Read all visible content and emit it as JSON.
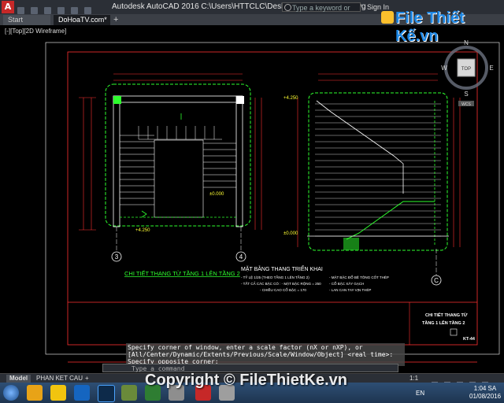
{
  "titlebar": {
    "app_logo": "A",
    "title": "Autodesk AutoCAD 2016    C:\\Users\\HTTCLC\\Desktop\\DoHoaTV.com.dwg",
    "search_placeholder": "Type a keyword or phrase",
    "sign_in": "Sign In"
  },
  "tabs": [
    {
      "label": "Start"
    },
    {
      "label": "DoHoaTV.com*"
    }
  ],
  "tab_plus": "+",
  "viewport": {
    "label": "[-][Top][2D Wireframe]"
  },
  "viewcube": {
    "top_label": "TOP",
    "north": "N",
    "south": "S",
    "east": "E",
    "west": "W",
    "wcs": "WCS"
  },
  "drawing": {
    "plan_title": "CHI TIẾT THANG TỪ TẦNG 1 LÊN TẦNG 2",
    "section_title": "MẶT BẰNG THANG TRIỂN KHAI",
    "grid_3": "3",
    "grid_4": "4",
    "grid_c": "C",
    "level_0": "±0.000",
    "level_2": "+4.250",
    "level_3": "+4.250",
    "level_4": "±0.000",
    "right_box_title_1": "CHI TIẾT THANG TỪ",
    "right_box_title_2": "TẦNG 1 LÊN TẦNG 2",
    "sheet_code": "KT-44",
    "note_left_1": "- TỶ LỆ 1/25 (THEO TẦNG 1 LÊN TẦNG 2)",
    "note_left_2": "- TẤT CẢ CÁC BẬC CÓ : - MẶT BẬC RỘNG = 250",
    "note_left_3": "- CHIỀU CAO CỔ BẬC = 170",
    "note_right_1": "- MẶT BẬC ĐỔ BÊ TÔNG CỐT THÉP",
    "note_right_2": "- CỔ BẬC XÂY GẠCH",
    "note_right_3": "- LAN CAN TAY VỊN THÉP"
  },
  "command": {
    "line1": "Specify corner of window, enter a scale factor (nX or nXP), or",
    "line2": "[All/Center/Dynamic/Extents/Previous/Scale/Window/Object] <real time>:",
    "line3": "Specify opposite corner:",
    "input_placeholder": "Type a command"
  },
  "status": {
    "model_tab": "Model",
    "layout_tab": "PHAN KET CAU",
    "add": "+",
    "scale": "1:1"
  },
  "taskbar": {
    "lang": "EN",
    "time": "1:04 SA",
    "date": "01/08/2016"
  },
  "overlay": {
    "logo_text": "File Thiết Kế.vn",
    "watermark": "Copyright © FileThietKe.vn"
  }
}
